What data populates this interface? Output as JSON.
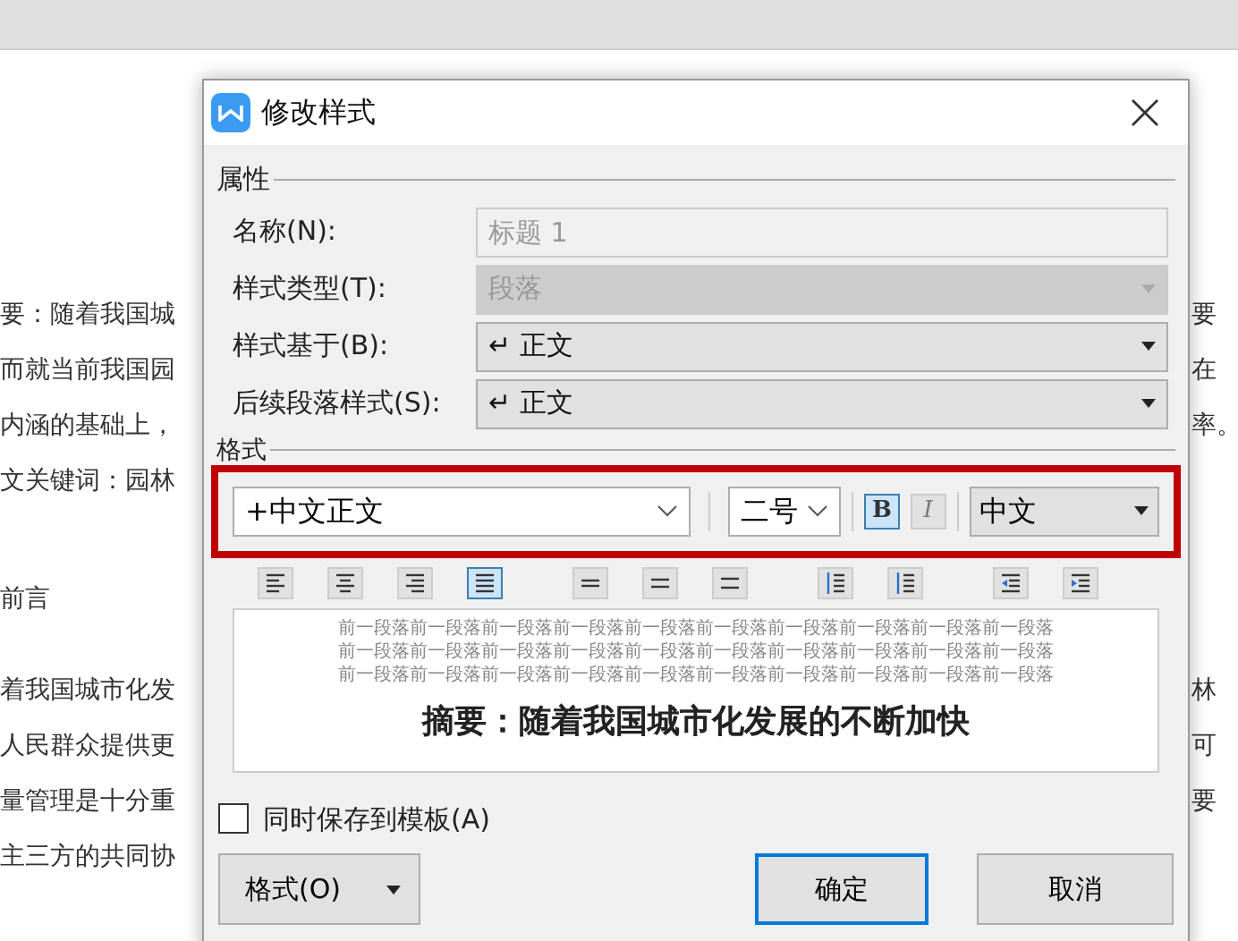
{
  "document": {
    "lines": [
      {
        "left": "要：随着我国城",
        "right": "要"
      },
      {
        "left": "而就当前我国园",
        "right": "在"
      },
      {
        "left": "内涵的基础上，",
        "right": "率。"
      },
      {
        "left": "文关键词：园林"
      },
      {
        "left": "前言"
      },
      {
        "left": "着我国城市化发",
        "right": "林"
      },
      {
        "left": "人民群众提供更",
        "right": "可"
      },
      {
        "left": "量管理是十分重",
        "right": "要"
      },
      {
        "left": "主三方的共同协"
      }
    ]
  },
  "dialog": {
    "title": "修改样式",
    "properties": {
      "heading": "属性",
      "fields": [
        {
          "label": "名称(N):",
          "kind": "text",
          "placeholder": "标题 1",
          "disabled": true
        },
        {
          "label": "样式类型(T):",
          "kind": "select",
          "value": "段落",
          "disabled": true
        },
        {
          "label": "样式基于(B):",
          "kind": "select",
          "value": "↵ 正文",
          "disabled": false
        },
        {
          "label": "后续段落样式(S):",
          "kind": "select",
          "value": "↵ 正文",
          "disabled": false
        }
      ]
    },
    "format": {
      "heading": "格式",
      "font": "+中文正文",
      "size": "二号",
      "bold": true,
      "italic": false,
      "bold_label": "B",
      "italic_label": "I",
      "script": "中文",
      "tools": [
        {
          "kind": "align-left",
          "selected": false
        },
        {
          "kind": "align-center",
          "selected": false
        },
        {
          "kind": "align-right",
          "selected": false
        },
        {
          "kind": "justify",
          "selected": true
        },
        {
          "kind": "spacing-single",
          "selected": false
        },
        {
          "kind": "spacing-half",
          "selected": false
        },
        {
          "kind": "spacing-double",
          "selected": false
        },
        {
          "kind": "space-add",
          "selected": false
        },
        {
          "kind": "space-remove",
          "selected": false
        },
        {
          "kind": "indent-less",
          "selected": false
        },
        {
          "kind": "indent-more",
          "selected": false
        }
      ]
    },
    "preview": {
      "previous": [
        "前一段落前一段落前一段落前一段落前一段落前一段落前一段落前一段落前一段落前一段落",
        "前一段落前一段落前一段落前一段落前一段落前一段落前一段落前一段落前一段落前一段落",
        "前一段落前一段落前一段落前一段落前一段落前一段落前一段落前一段落前一段落前一段落"
      ],
      "sample": "摘要：随着我国城市化发展的不断加快"
    },
    "save_to_template": {
      "label": "同时保存到模板(A)",
      "checked": false
    },
    "buttons": {
      "format": "格式(O)",
      "ok": "确定",
      "cancel": "取消"
    }
  }
}
